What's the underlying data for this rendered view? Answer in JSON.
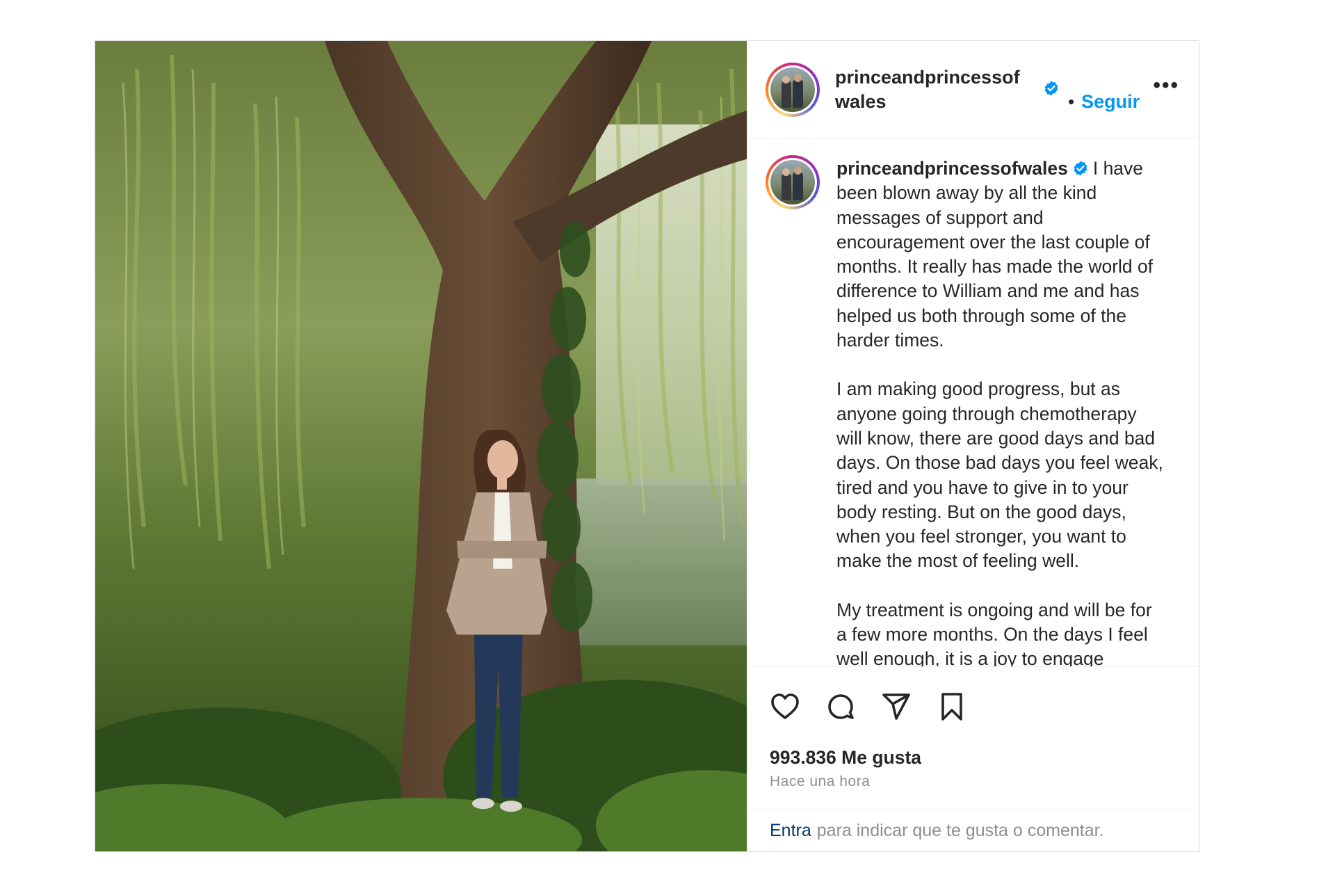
{
  "post": {
    "username": "princeandprincessofwales",
    "follow_label": "Seguir",
    "separator": "•",
    "more_label": "•••",
    "caption_paragraphs": [
      "I have been blown away by all the kind messages of support and encouragement over the last couple of months. It really has made the world of difference to William and me and has helped us both through some of the harder times.",
      "I am making good progress, but as anyone going through chemotherapy will know, there are good days and bad days. On those bad days you feel weak, tired and you have to give in to your body resting. But on the good days, when you feel stronger, you want to make the most of feeling well.",
      "My treatment is ongoing and will be for a few more months. On the days I feel well enough, it is a joy to engage"
    ],
    "likes_text": "993.836 Me gusta",
    "time_text": "Hace una hora",
    "footer_link": "Entra",
    "footer_text": "para indicar que te gusta o comentar."
  },
  "icons": {
    "like": "heart-icon",
    "comment": "comment-icon",
    "share": "paper-plane-icon",
    "save": "bookmark-icon",
    "verified": "verified-badge-icon"
  },
  "colors": {
    "accent_blue": "#0095f6",
    "link_dark_blue": "#00376b",
    "text": "#262626",
    "muted": "#8e8e8e",
    "verified": "#0095f6"
  }
}
